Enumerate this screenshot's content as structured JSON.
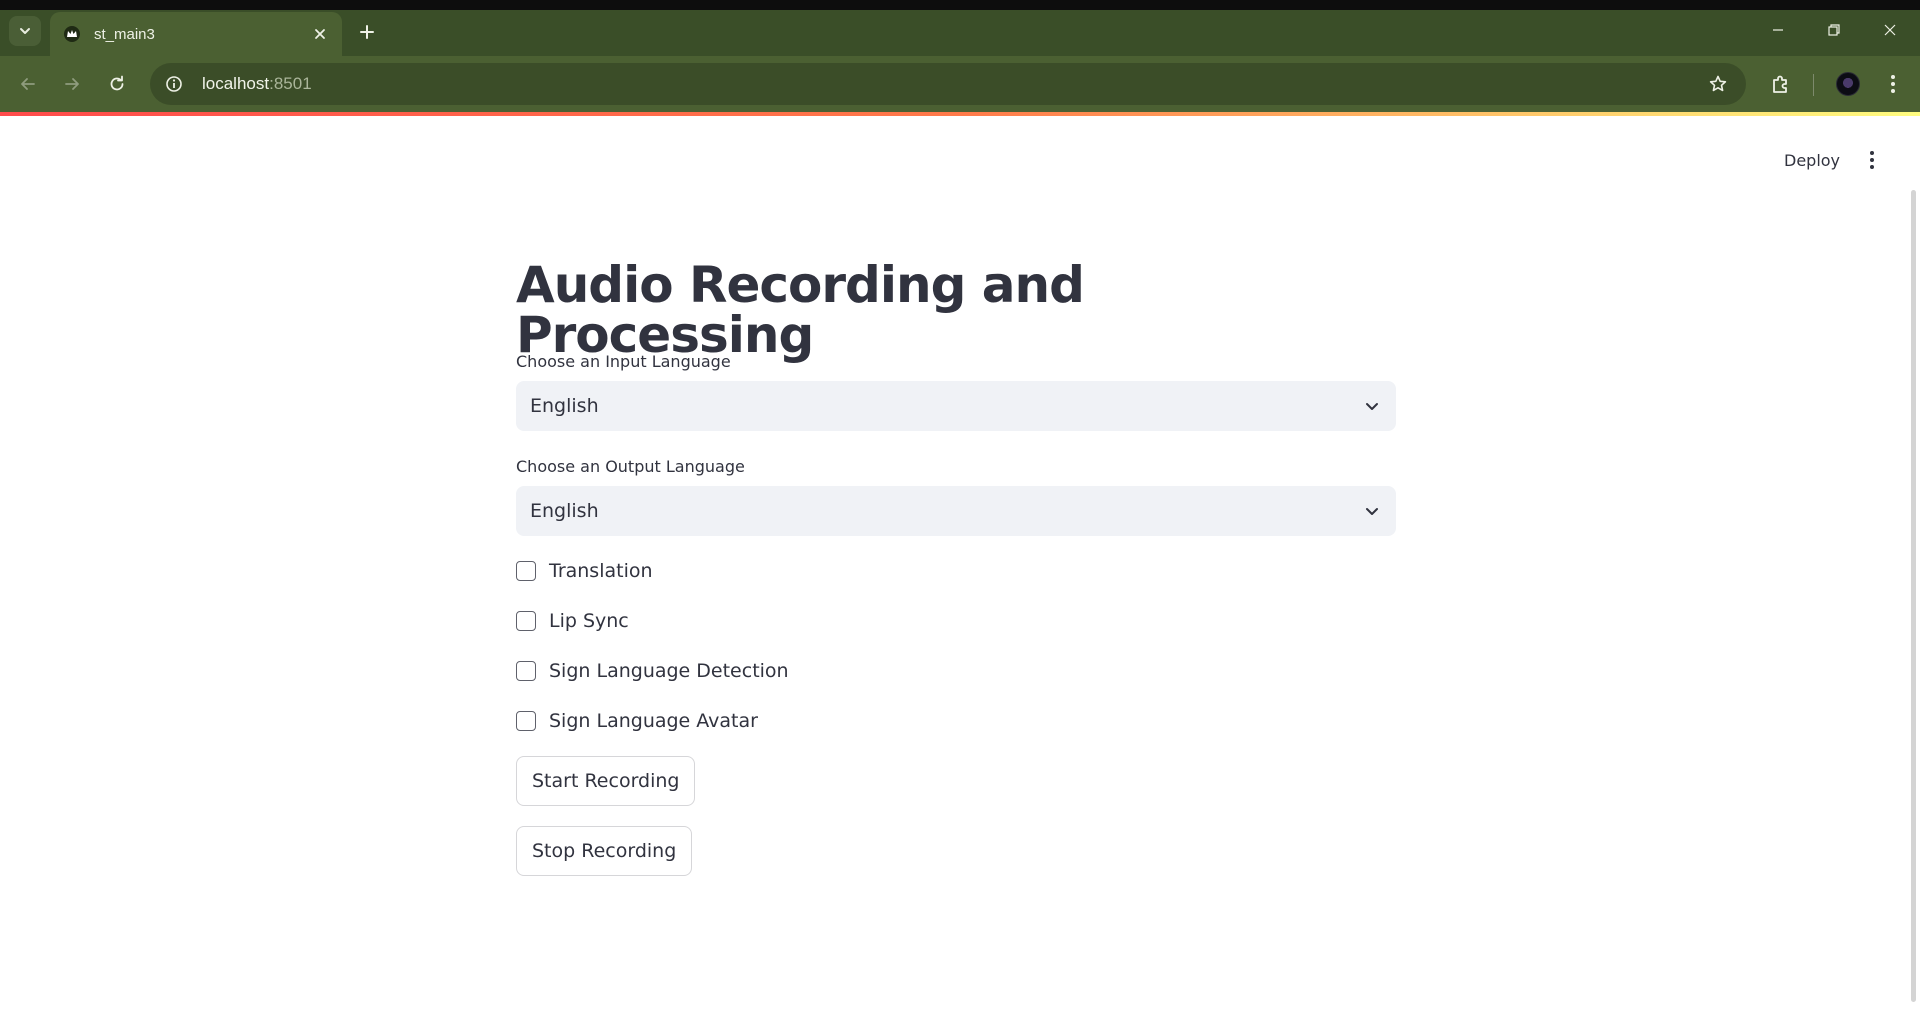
{
  "browser": {
    "tab_title": "st_main3",
    "url_host": "localhost",
    "url_port": ":8501"
  },
  "header": {
    "deploy_label": "Deploy"
  },
  "main": {
    "title": "Audio Recording and Processing",
    "input_language": {
      "label": "Choose an Input Language",
      "selected": "English"
    },
    "output_language": {
      "label": "Choose an Output Language",
      "selected": "English"
    },
    "options": [
      {
        "label": "Translation",
        "checked": false
      },
      {
        "label": "Lip Sync",
        "checked": false
      },
      {
        "label": "Sign Language Detection",
        "checked": false
      },
      {
        "label": "Sign Language Avatar",
        "checked": false
      }
    ],
    "buttons": {
      "start": "Start Recording",
      "stop": "Stop Recording"
    }
  },
  "colors": {
    "text": "#31333f",
    "select_bg": "#f0f2f6",
    "chrome_toolbar": "#4b6032",
    "chrome_tabbar": "#3a4e28",
    "accent_red": "#ff4b4b",
    "accent_yellow": "#fffd80"
  }
}
